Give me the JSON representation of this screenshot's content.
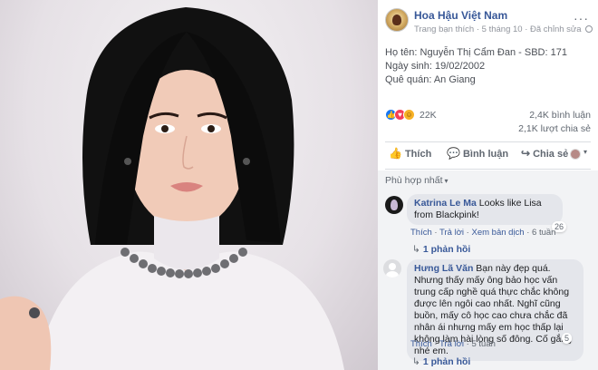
{
  "page": {
    "name": "Hoa Hậu Việt Nam",
    "meta_prefix": "Trang bạn thích",
    "date": "5 tháng 10",
    "audience": "Đã chỉnh sửa",
    "more": "···"
  },
  "post": {
    "lines": [
      "Họ tên: Nguyễn Thị Cẩm Đan - SBD: 171",
      "Ngày sinh: 19/02/2002",
      "Quê quán: An Giang"
    ]
  },
  "reactions": {
    "count": "22K",
    "comments": "2,4K bình luận",
    "shares": "2,1K lượt chia sẻ",
    "like_glyph": "👍",
    "love_glyph": "♥",
    "haha_glyph": "☺"
  },
  "actions": {
    "like": "Thích",
    "comment": "Bình luận",
    "share": "Chia sẻ",
    "like_glyph": "👍",
    "comment_glyph": "💬",
    "share_glyph": "↪",
    "caret": "▾"
  },
  "comments": {
    "sort_label": "Phù hợp nhất",
    "sort_caret": "▾",
    "items": [
      {
        "author": "Katrina Le Ma",
        "text": "Looks like Lisa from Blackpink!",
        "reaction_count": "26",
        "actions": [
          "Thích",
          "Trả lời",
          "Xem bản dịch",
          "6 tuần"
        ],
        "replies": "1 phản hồi"
      },
      {
        "author": "Hưng Lã Văn",
        "text": "Bạn này đẹp quá. Nhưng thấy mấy ông bảo học vấn trung cấp nghề quá thực chắc không được lên ngôi cao nhất. Nghĩ cũng buồn, mấy cô học cao chưa chắc đã nhân ái nhưng mấy em học thấp lại không làm hài lòng số đông. Cố gắng nhé em.",
        "reaction_count": "5",
        "actions": [
          "Thích",
          "Trả lời",
          "5 tuần"
        ],
        "replies": "1 phản hồi"
      }
    ],
    "reply_arrow": "↳"
  },
  "colors": {
    "link": "#385898",
    "meta": "#90949c",
    "like": "#1877f2",
    "love": "#f33e58",
    "haha": "#f7b125"
  }
}
